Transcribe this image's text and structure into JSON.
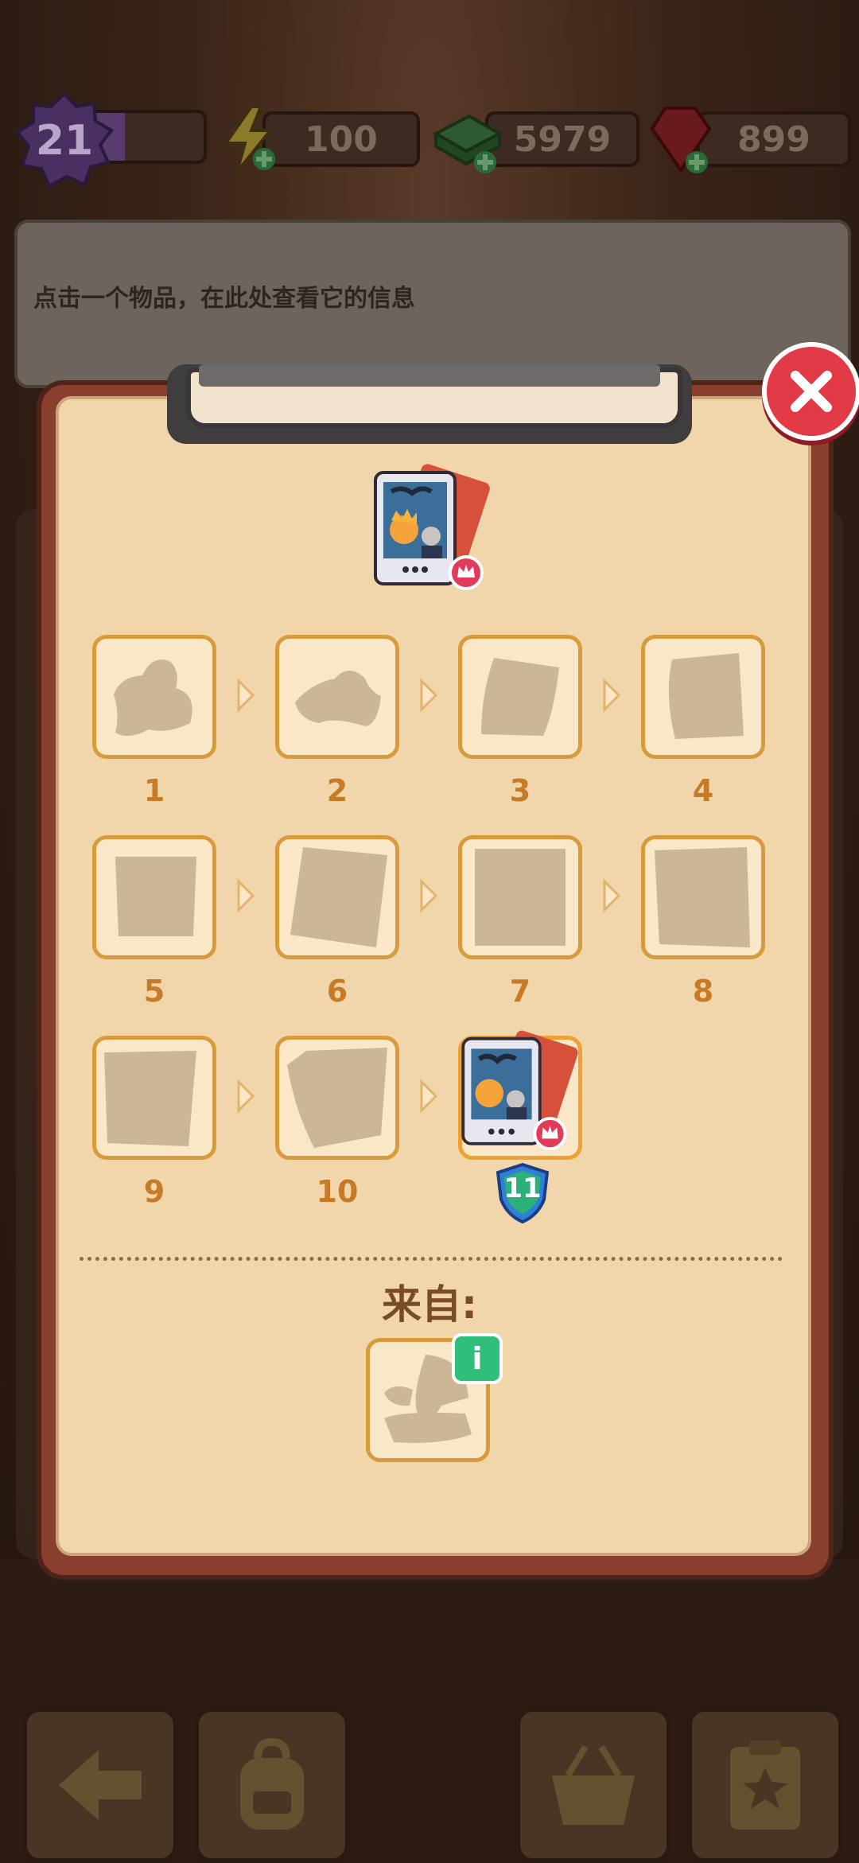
{
  "header": {
    "level": "21",
    "xp_fraction": 0.3,
    "energy": "100",
    "cash": "5979",
    "gems": "899"
  },
  "info_banner": {
    "text": "点击一个物品，在此处查看它的信息"
  },
  "chain": {
    "items": [
      {
        "label": "1"
      },
      {
        "label": "2"
      },
      {
        "label": "3"
      },
      {
        "label": "4"
      },
      {
        "label": "5"
      },
      {
        "label": "6"
      },
      {
        "label": "7"
      },
      {
        "label": "8"
      },
      {
        "label": "9"
      },
      {
        "label": "10"
      }
    ],
    "final_level": "11"
  },
  "source": {
    "title": "来自:",
    "info_glyph": "i"
  },
  "colors": {
    "tile_border": "#d99a3c",
    "label": "#c77b26",
    "close": "#e23a44",
    "info": "#2fbf7a"
  },
  "icons": {
    "energy": "lightning-icon",
    "cash": "cash-stack-icon",
    "gems": "ruby-icon",
    "close": "close-icon",
    "nav": [
      "back-arrow-icon",
      "backpack-icon",
      "basket-icon",
      "clipboard-star-icon"
    ]
  }
}
